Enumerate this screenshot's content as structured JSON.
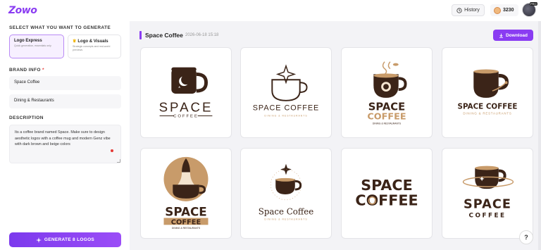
{
  "app": {
    "brand": "Zowo"
  },
  "topbar": {
    "history_label": "History",
    "credits": "3230",
    "avatar_badge": "PRO"
  },
  "sidebar": {
    "select_title": "SELECT WHAT YOU WANT TO GENERATE",
    "modes": [
      {
        "title": "Logo Express",
        "subtitle": "Quick generation, essentials only"
      },
      {
        "title": "Logo & Visuals",
        "subtitle": "Strategic concepts and real-world previews"
      }
    ],
    "brand_info_title": "BRAND INFO",
    "brand_info_required": "*",
    "brand_name": "Space Coffee",
    "industry": "Dining & Restaurants",
    "description_title": "DESCRIPTION",
    "description_text": "Its a coffee brand named Space. Make sure to design aesthetic logos with a coffee mug and modern Genz vibe with dark brown and beige colors",
    "generate_label": "GENERATE 8 LOGOS"
  },
  "main": {
    "project_title": "Space Coffee",
    "project_date": "2026-06-18 15:18",
    "download_label": "Download"
  },
  "logos": [
    {
      "line1": "SPACE",
      "line2": "COFFEE"
    },
    {
      "line1": "SPACE COFFEE",
      "line2": "DINING & RESTAURANTS"
    },
    {
      "line1": "SPACE",
      "line2": "COFFEE",
      "line3": "DINING & RESTAURANTS"
    },
    {
      "line1": "SPACE COFFEE",
      "line2": "DINING & RESTAURANTS"
    },
    {
      "line1": "SPACE",
      "line2": "COFFEE",
      "line3": "DINING & RESTAURANTS"
    },
    {
      "line1": "Space Coffee",
      "line2": "DINING & RESTAURANTS"
    },
    {
      "line1": "SPACE",
      "line2": "COFFEE"
    },
    {
      "line1": "SPACE",
      "line2": "COFFEE"
    }
  ],
  "help_label": "?",
  "colors": {
    "accent": "#8a3cf2",
    "brown": "#3b2418",
    "beige": "#c89b6a"
  }
}
